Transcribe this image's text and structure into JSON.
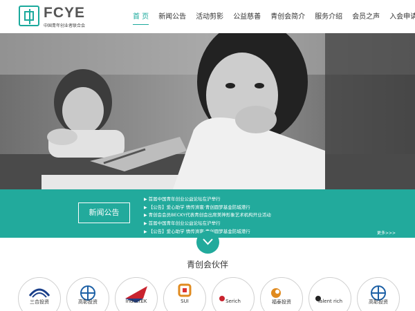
{
  "header": {
    "logo_name": "FCYE",
    "logo_subtitle": "中国青年创业者联合会",
    "nav": [
      {
        "label": "首 页",
        "active": true
      },
      {
        "label": "新闻公告",
        "active": false
      },
      {
        "label": "活动剪影",
        "active": false
      },
      {
        "label": "公益慈善",
        "active": false
      },
      {
        "label": "青创会简介",
        "active": false
      },
      {
        "label": "服务介绍",
        "active": false
      },
      {
        "label": "会员之声",
        "active": false
      },
      {
        "label": "入会申请",
        "active": false
      }
    ]
  },
  "news": {
    "tag": "新闻公告",
    "bullet": "▶",
    "items": [
      "首届中国青年创业公益论坛在沪举行",
      "【公告】爱心助学 情传濟寰·青创圆梦基金防城港行",
      "青创会会员BECKY代表青创会出席美神形象艺术机构开业活动",
      "首届中国青年创业公益论坛在沪举行",
      "【公告】爱心助学 情传濟寰·青创圆梦基金防城港行"
    ],
    "more": "更多>>>"
  },
  "partners": {
    "title": "青创会伙伴",
    "logos": [
      {
        "name": "shine-investment",
        "label": "三合投资"
      },
      {
        "name": "partner-2",
        "label": "高彰投资"
      },
      {
        "name": "inductek",
        "label": "InductEK"
      },
      {
        "name": "sui",
        "label": "SUI"
      },
      {
        "name": "serich",
        "label": "Serich"
      },
      {
        "name": "partner-6",
        "label": "福泰投资"
      },
      {
        "name": "talent-rich",
        "label": "Talent rich"
      },
      {
        "name": "partner-8",
        "label": "高彰投资"
      }
    ]
  },
  "colors": {
    "accent": "#22aa9c",
    "brand": "#1aa99c"
  }
}
